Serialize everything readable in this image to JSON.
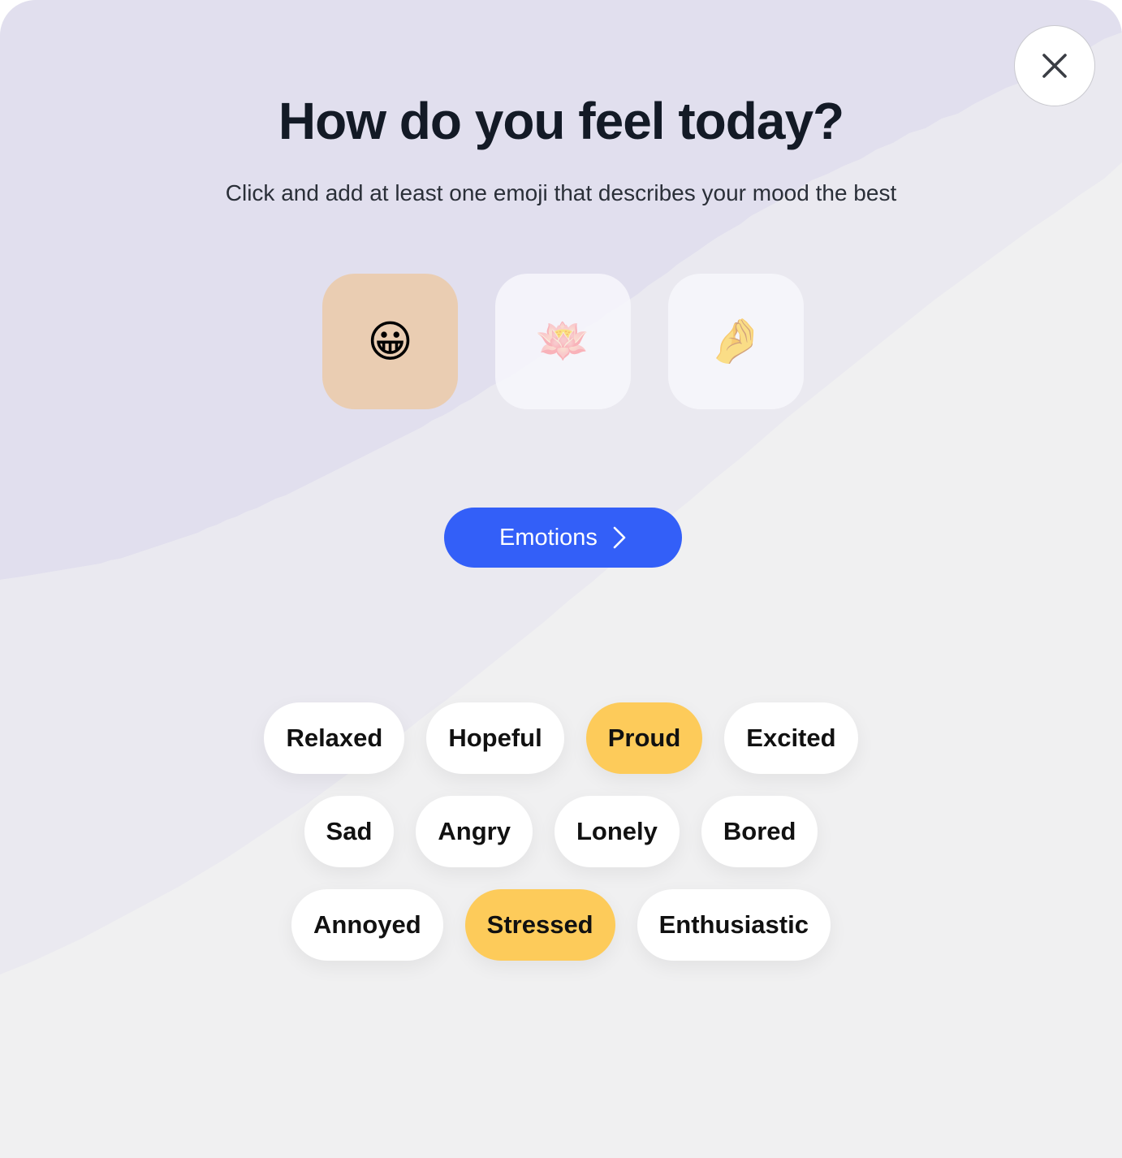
{
  "dialog": {
    "title": "How do you feel today?",
    "subtitle": "Click and add at least one emoji that describes your mood the best",
    "close_icon": "close-icon"
  },
  "emoji_options": [
    {
      "emoji": "😀",
      "label": "grinning-face",
      "selected": true
    },
    {
      "emoji": "🪷",
      "label": "lotus",
      "selected": false
    },
    {
      "emoji": "🤌",
      "label": "pinched-fingers",
      "selected": false
    }
  ],
  "emotions_button": {
    "label": "Emotions",
    "icon": "chevron-right-icon"
  },
  "emotion_chips": {
    "rows": [
      [
        {
          "label": "Relaxed",
          "selected": false
        },
        {
          "label": "Hopeful",
          "selected": false
        },
        {
          "label": "Proud",
          "selected": true
        },
        {
          "label": "Excited",
          "selected": false
        }
      ],
      [
        {
          "label": "Sad",
          "selected": false
        },
        {
          "label": "Angry",
          "selected": false
        },
        {
          "label": "Lonely",
          "selected": false
        },
        {
          "label": "Bored",
          "selected": false
        }
      ],
      [
        {
          "label": "Annoyed",
          "selected": false
        },
        {
          "label": "Stressed",
          "selected": true
        },
        {
          "label": "Enthusiastic",
          "selected": false
        }
      ]
    ]
  },
  "colors": {
    "accent_blue": "#335ff8",
    "selected_chip": "#fdcb5a",
    "selected_emoji_tile": "#eacdb2",
    "title_text": "#131a26",
    "background_lavender": "#e1dfee",
    "background_gray": "#f0f0f1"
  }
}
